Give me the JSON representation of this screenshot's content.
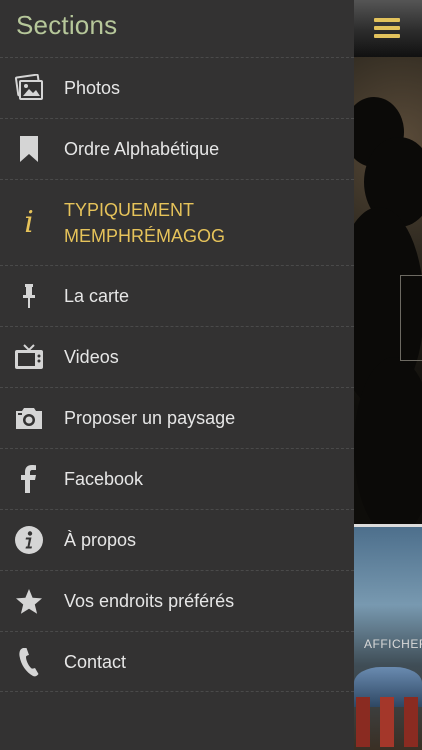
{
  "drawer": {
    "title": "Sections",
    "items": [
      {
        "label": "Photos",
        "icon": "photos-icon"
      },
      {
        "label": "Ordre Alphabétique",
        "icon": "bookmark-icon"
      },
      {
        "label": "TYPIQUEMENT MEMPHRÉMAGOG",
        "icon": "info-italic-icon",
        "active": true
      },
      {
        "label": "La carte",
        "icon": "pin-icon"
      },
      {
        "label": "Videos",
        "icon": "tv-icon"
      },
      {
        "label": "Proposer un paysage",
        "icon": "camera-icon"
      },
      {
        "label": "Facebook",
        "icon": "facebook-icon"
      },
      {
        "label": "À propos",
        "icon": "info-circle-icon"
      },
      {
        "label": "Vos endroits préférés",
        "icon": "star-icon"
      },
      {
        "label": "Contact",
        "icon": "phone-icon"
      }
    ]
  },
  "content": {
    "button_label": "AFFICHER"
  },
  "colors": {
    "drawer_bg": "#333232",
    "title": "#b6c79a",
    "active": "#e6c35a",
    "icon": "#d5d5d5",
    "hamburger": "#e2c25c"
  }
}
